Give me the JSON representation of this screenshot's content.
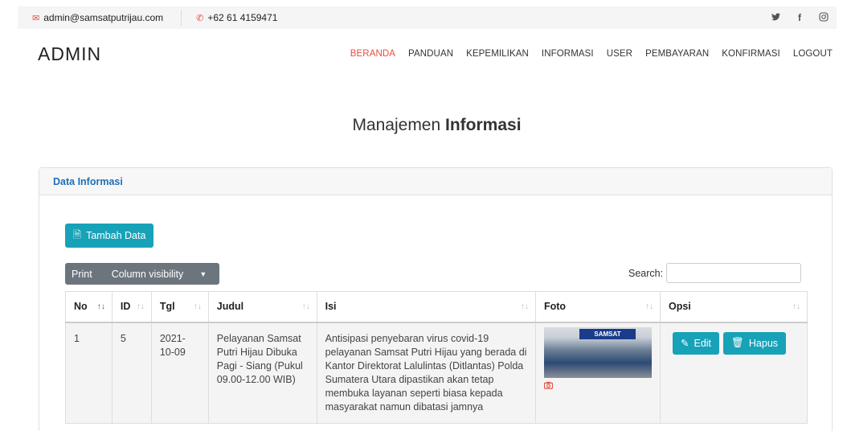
{
  "topbar": {
    "email": "admin@samsatputrijau.com",
    "phone": "+62 61 4159471",
    "social": [
      "twitter-icon",
      "facebook-icon",
      "instagram-icon"
    ]
  },
  "brand": "ADMIN",
  "nav": [
    {
      "label": "BERANDA",
      "active": true
    },
    {
      "label": "PANDUAN"
    },
    {
      "label": "KEPEMILIKAN"
    },
    {
      "label": "INFORMASI"
    },
    {
      "label": "USER"
    },
    {
      "label": "PEMBAYARAN"
    },
    {
      "label": "KONFIRMASI"
    },
    {
      "label": "LOGOUT"
    }
  ],
  "title": {
    "prefix": "Manajemen",
    "bold": "Informasi"
  },
  "card": {
    "header": "Data Informasi",
    "add_button": "Tambah Data",
    "print_button": "Print",
    "colvis_button": "Column visibility",
    "search_label": "Search:",
    "search_value": ""
  },
  "table": {
    "columns": [
      "No",
      "ID",
      "Tgl",
      "Judul",
      "Isi",
      "Foto",
      "Opsi"
    ],
    "rows": [
      {
        "no": "1",
        "id": "5",
        "tgl": "2021-10-09",
        "judul": "Pelayanan Samsat Putri Hijau Dibuka Pagi - Siang (Pukul 09.00-12.00 WIB)",
        "isi": "Antisipasi penyebaran virus covid-19 pelayanan Samsat Putri Hijau yang berada di Kantor Direktorat Lalulintas (Ditlantas) Polda Sumatera Utara dipastikan akan tetap membuka layanan seperti biasa kepada masyarakat namun dibatasi jamnya",
        "photo_sign": "SAMSAT",
        "edit": "Edit",
        "hapus": "Hapus"
      }
    ]
  },
  "colors": {
    "accent": "#17a2b8",
    "active_nav": "#e74c3c",
    "header_text": "#1f6fb8",
    "secondary": "#6c757d"
  }
}
